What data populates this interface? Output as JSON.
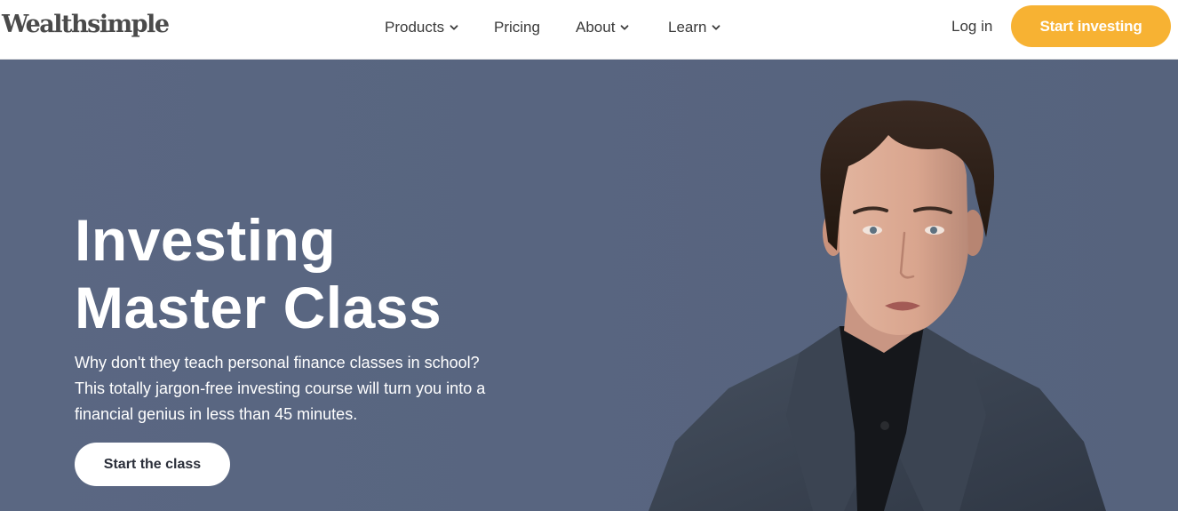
{
  "brand": {
    "name": "Wealthsimple"
  },
  "nav": {
    "items": [
      {
        "label": "Products",
        "has_dropdown": true
      },
      {
        "label": "Pricing",
        "has_dropdown": false
      },
      {
        "label": "About",
        "has_dropdown": true
      },
      {
        "label": "Learn",
        "has_dropdown": true
      }
    ],
    "login_label": "Log in",
    "cta_label": "Start investing"
  },
  "hero": {
    "title_lines": [
      "Investing",
      "Master Class"
    ],
    "description_lines": [
      "Why don't they teach personal finance classes in school?",
      "This totally jargon-free investing course will turn you into a",
      "financial genius in less than 45 minutes."
    ],
    "cta_label": "Start the class"
  },
  "colors": {
    "accent": "#f7b233",
    "hero_bg": "#58657f",
    "nav_text": "#3a3a3a"
  },
  "icons": {
    "dropdown": "chevron-down-icon"
  }
}
